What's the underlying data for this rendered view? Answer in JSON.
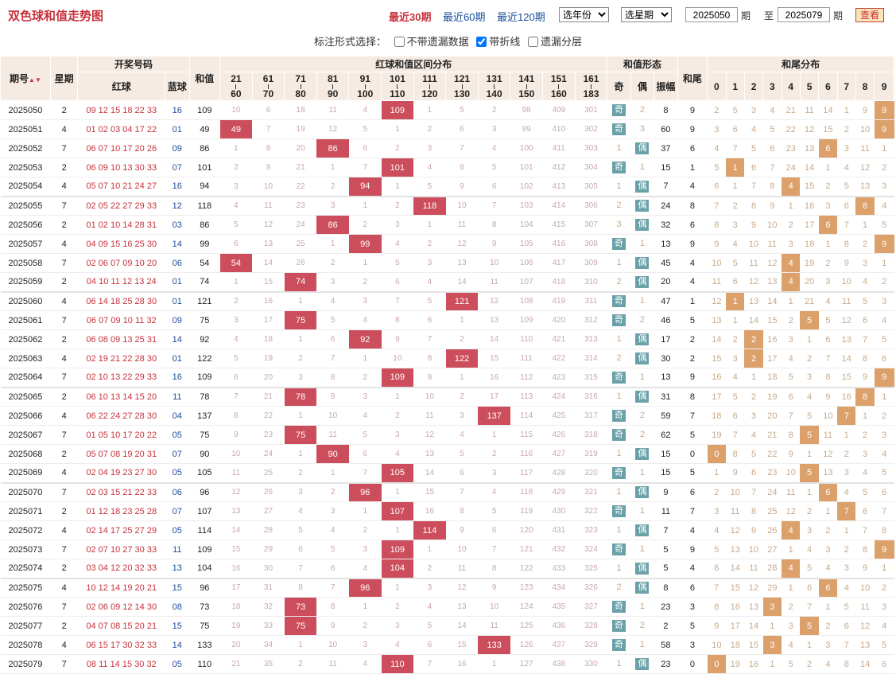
{
  "title": "双色球和值走势图",
  "ranges": [
    "最近30期",
    "最近60期",
    "最近120期"
  ],
  "selects": {
    "year": "选年份",
    "issue": "选星期"
  },
  "from_value": "2025050",
  "issue_word": "期",
  "to_word": "至",
  "to_value": "2025079",
  "query_btn": "查看",
  "options": {
    "label": "标注形式选择：",
    "opt1": "不带遗漏数据",
    "opt2": "带折线",
    "opt3": "遗漏分层",
    "opt2_checked": true
  },
  "header": {
    "issue": "期号",
    "sort": "▲▼",
    "week": "星期",
    "draw": "开奖号码",
    "red": "红球",
    "blue": "蓝球",
    "sum": "和值",
    "dist": "红球和值区间分布",
    "form": "和值形态",
    "odd": "奇",
    "even": "偶",
    "amp": "振幅",
    "tail": "和尾",
    "taildist": "和尾分布",
    "ranges": [
      [
        "21",
        "60"
      ],
      [
        "61",
        "70"
      ],
      [
        "71",
        "80"
      ],
      [
        "81",
        "90"
      ],
      [
        "91",
        "100"
      ],
      [
        "101",
        "110"
      ],
      [
        "111",
        "120"
      ],
      [
        "121",
        "130"
      ],
      [
        "131",
        "140"
      ],
      [
        "141",
        "150"
      ],
      [
        "151",
        "160"
      ],
      [
        "161",
        "183"
      ]
    ],
    "digits": [
      "0",
      "1",
      "2",
      "3",
      "4",
      "5",
      "6",
      "7",
      "8",
      "9"
    ]
  },
  "rows": [
    {
      "issue": "2025050",
      "week": "2",
      "red": "09 12 15 18 22 33",
      "blue": "16",
      "sum": "109",
      "dist": [
        "10",
        "6",
        "18",
        "11",
        "4",
        "109",
        "1",
        "5",
        "2",
        "98",
        "409",
        "301"
      ],
      "hit": 5,
      "odd": true,
      "p": "2",
      "amp": "8",
      "tail": "9",
      "td": [
        "2",
        "5",
        "3",
        "4",
        "21",
        "11",
        "14",
        "1",
        "9",
        "9"
      ],
      "th": 9
    },
    {
      "issue": "2025051",
      "week": "4",
      "red": "01 02 03 04 17 22",
      "blue": "01",
      "sum": "49",
      "dist": [
        "49",
        "7",
        "19",
        "12",
        "5",
        "1",
        "2",
        "6",
        "3",
        "99",
        "410",
        "302"
      ],
      "hit": 0,
      "odd": true,
      "p": "3",
      "amp": "60",
      "tail": "9",
      "td": [
        "3",
        "6",
        "4",
        "5",
        "22",
        "12",
        "15",
        "2",
        "10",
        "9"
      ],
      "th": 9
    },
    {
      "issue": "2025052",
      "week": "7",
      "red": "06 07 10 17 20 26",
      "blue": "09",
      "sum": "86",
      "dist": [
        "1",
        "8",
        "20",
        "86",
        "6",
        "2",
        "3",
        "7",
        "4",
        "100",
        "411",
        "303"
      ],
      "hit": 3,
      "odd": false,
      "p": "1",
      "amp": "37",
      "tail": "6",
      "td": [
        "4",
        "7",
        "5",
        "6",
        "23",
        "13",
        "6",
        "3",
        "11",
        "1"
      ],
      "th": 6
    },
    {
      "issue": "2025053",
      "week": "2",
      "red": "06 09 10 13 30 33",
      "blue": "07",
      "sum": "101",
      "dist": [
        "2",
        "9",
        "21",
        "1",
        "7",
        "101",
        "4",
        "8",
        "5",
        "101",
        "412",
        "304"
      ],
      "hit": 5,
      "odd": true,
      "p": "1",
      "amp": "15",
      "tail": "1",
      "td": [
        "5",
        "1",
        "6",
        "7",
        "24",
        "14",
        "1",
        "4",
        "12",
        "2"
      ],
      "th": 1
    },
    {
      "issue": "2025054",
      "week": "4",
      "red": "05 07 10 21 24 27",
      "blue": "16",
      "sum": "94",
      "dist": [
        "3",
        "10",
        "22",
        "2",
        "94",
        "1",
        "5",
        "9",
        "6",
        "102",
        "413",
        "305"
      ],
      "hit": 4,
      "odd": false,
      "p": "1",
      "amp": "7",
      "tail": "4",
      "td": [
        "6",
        "1",
        "7",
        "8",
        "4",
        "15",
        "2",
        "5",
        "13",
        "3"
      ],
      "th": 4
    },
    {
      "issue": "2025055",
      "week": "7",
      "red": "02 05 22 27 29 33",
      "blue": "12",
      "sum": "118",
      "dist": [
        "4",
        "11",
        "23",
        "3",
        "1",
        "2",
        "118",
        "10",
        "7",
        "103",
        "414",
        "306"
      ],
      "hit": 6,
      "odd": false,
      "p": "2",
      "amp": "24",
      "tail": "8",
      "td": [
        "7",
        "2",
        "8",
        "9",
        "1",
        "16",
        "3",
        "6",
        "8",
        "4"
      ],
      "th": 8
    },
    {
      "issue": "2025056",
      "week": "2",
      "red": "01 02 10 14 28 31",
      "blue": "03",
      "sum": "86",
      "dist": [
        "5",
        "12",
        "24",
        "86",
        "2",
        "3",
        "1",
        "11",
        "8",
        "104",
        "415",
        "307"
      ],
      "hit": 3,
      "odd": false,
      "p": "3",
      "amp": "32",
      "tail": "6",
      "td": [
        "8",
        "3",
        "9",
        "10",
        "2",
        "17",
        "6",
        "7",
        "1",
        "5"
      ],
      "th": 6
    },
    {
      "issue": "2025057",
      "week": "4",
      "red": "04 09 15 16 25 30",
      "blue": "14",
      "sum": "99",
      "dist": [
        "6",
        "13",
        "25",
        "1",
        "99",
        "4",
        "2",
        "12",
        "9",
        "105",
        "416",
        "308"
      ],
      "hit": 4,
      "odd": true,
      "p": "1",
      "amp": "13",
      "tail": "9",
      "td": [
        "9",
        "4",
        "10",
        "11",
        "3",
        "18",
        "1",
        "8",
        "2",
        "9"
      ],
      "th": 9
    },
    {
      "issue": "2025058",
      "week": "7",
      "red": "02 06 07 09 10 20",
      "blue": "06",
      "sum": "54",
      "dist": [
        "54",
        "14",
        "26",
        "2",
        "1",
        "5",
        "3",
        "13",
        "10",
        "106",
        "417",
        "309"
      ],
      "hit": 0,
      "odd": false,
      "p": "1",
      "amp": "45",
      "tail": "4",
      "td": [
        "10",
        "5",
        "11",
        "12",
        "4",
        "19",
        "2",
        "9",
        "3",
        "1"
      ],
      "th": 4
    },
    {
      "issue": "2025059",
      "week": "2",
      "red": "04 10 11 12 13 24",
      "blue": "01",
      "sum": "74",
      "dist": [
        "1",
        "15",
        "74",
        "3",
        "2",
        "6",
        "4",
        "14",
        "11",
        "107",
        "418",
        "310"
      ],
      "hit": 2,
      "odd": false,
      "p": "2",
      "amp": "20",
      "tail": "4",
      "td": [
        "11",
        "6",
        "12",
        "13",
        "4",
        "20",
        "3",
        "10",
        "4",
        "2"
      ],
      "th": 4
    },
    {
      "issue": "2025060",
      "week": "4",
      "red": "06 14 18 25 28 30",
      "blue": "01",
      "sum": "121",
      "dist": [
        "2",
        "16",
        "1",
        "4",
        "3",
        "7",
        "5",
        "121",
        "12",
        "108",
        "419",
        "311"
      ],
      "hit": 7,
      "odd": true,
      "p": "1",
      "amp": "47",
      "tail": "1",
      "td": [
        "12",
        "1",
        "13",
        "14",
        "1",
        "21",
        "4",
        "11",
        "5",
        "3"
      ],
      "th": 1
    },
    {
      "issue": "2025061",
      "week": "7",
      "red": "06 07 09 10 11 32",
      "blue": "09",
      "sum": "75",
      "dist": [
        "3",
        "17",
        "75",
        "5",
        "4",
        "8",
        "6",
        "1",
        "13",
        "109",
        "420",
        "312"
      ],
      "hit": 2,
      "odd": true,
      "p": "2",
      "amp": "46",
      "tail": "5",
      "td": [
        "13",
        "1",
        "14",
        "15",
        "2",
        "5",
        "5",
        "12",
        "6",
        "4"
      ],
      "th": 5
    },
    {
      "issue": "2025062",
      "week": "2",
      "red": "06 08 09 13 25 31",
      "blue": "14",
      "sum": "92",
      "dist": [
        "4",
        "18",
        "1",
        "6",
        "92",
        "9",
        "7",
        "2",
        "14",
        "110",
        "421",
        "313"
      ],
      "hit": 4,
      "odd": false,
      "p": "1",
      "amp": "17",
      "tail": "2",
      "td": [
        "14",
        "2",
        "2",
        "16",
        "3",
        "1",
        "6",
        "13",
        "7",
        "5"
      ],
      "th": 2
    },
    {
      "issue": "2025063",
      "week": "4",
      "red": "02 19 21 22 28 30",
      "blue": "01",
      "sum": "122",
      "dist": [
        "5",
        "19",
        "2",
        "7",
        "1",
        "10",
        "8",
        "122",
        "15",
        "111",
        "422",
        "314"
      ],
      "hit": 7,
      "odd": false,
      "p": "2",
      "amp": "30",
      "tail": "2",
      "td": [
        "15",
        "3",
        "2",
        "17",
        "4",
        "2",
        "7",
        "14",
        "8",
        "6"
      ],
      "th": 2
    },
    {
      "issue": "2025064",
      "week": "7",
      "red": "02 10 13 22 29 33",
      "blue": "16",
      "sum": "109",
      "dist": [
        "6",
        "20",
        "3",
        "8",
        "2",
        "109",
        "9",
        "1",
        "16",
        "112",
        "423",
        "315"
      ],
      "hit": 5,
      "odd": true,
      "p": "1",
      "amp": "13",
      "tail": "9",
      "td": [
        "16",
        "4",
        "1",
        "18",
        "5",
        "3",
        "8",
        "15",
        "9",
        "9"
      ],
      "th": 9
    },
    {
      "issue": "2025065",
      "week": "2",
      "red": "06 10 13 14 15 20",
      "blue": "11",
      "sum": "78",
      "dist": [
        "7",
        "21",
        "78",
        "9",
        "3",
        "1",
        "10",
        "2",
        "17",
        "113",
        "424",
        "316"
      ],
      "hit": 2,
      "odd": false,
      "p": "1",
      "amp": "31",
      "tail": "8",
      "td": [
        "17",
        "5",
        "2",
        "19",
        "6",
        "4",
        "9",
        "16",
        "8",
        "1"
      ],
      "th": 8
    },
    {
      "issue": "2025066",
      "week": "4",
      "red": "06 22 24 27 28 30",
      "blue": "04",
      "sum": "137",
      "dist": [
        "8",
        "22",
        "1",
        "10",
        "4",
        "2",
        "11",
        "3",
        "137",
        "114",
        "425",
        "317"
      ],
      "hit": 8,
      "odd": true,
      "p": "2",
      "amp": "59",
      "tail": "7",
      "td": [
        "18",
        "6",
        "3",
        "20",
        "7",
        "5",
        "10",
        "7",
        "1",
        "2"
      ],
      "th": 7
    },
    {
      "issue": "2025067",
      "week": "7",
      "red": "01 05 10 17 20 22",
      "blue": "05",
      "sum": "75",
      "dist": [
        "9",
        "23",
        "75",
        "11",
        "5",
        "3",
        "12",
        "4",
        "1",
        "115",
        "426",
        "318"
      ],
      "hit": 2,
      "odd": true,
      "p": "2",
      "amp": "62",
      "tail": "5",
      "td": [
        "19",
        "7",
        "4",
        "21",
        "8",
        "5",
        "11",
        "1",
        "2",
        "3"
      ],
      "th": 5
    },
    {
      "issue": "2025068",
      "week": "2",
      "red": "05 07 08 19 20 31",
      "blue": "07",
      "sum": "90",
      "dist": [
        "10",
        "24",
        "1",
        "90",
        "6",
        "4",
        "13",
        "5",
        "2",
        "116",
        "427",
        "319"
      ],
      "hit": 3,
      "odd": false,
      "p": "1",
      "amp": "15",
      "tail": "0",
      "td": [
        "0",
        "8",
        "5",
        "22",
        "9",
        "1",
        "12",
        "2",
        "3",
        "4"
      ],
      "th": 0
    },
    {
      "issue": "2025069",
      "week": "4",
      "red": "02 04 19 23 27 30",
      "blue": "05",
      "sum": "105",
      "dist": [
        "11",
        "25",
        "2",
        "1",
        "7",
        "105",
        "14",
        "6",
        "3",
        "117",
        "428",
        "320"
      ],
      "hit": 5,
      "odd": true,
      "p": "1",
      "amp": "15",
      "tail": "5",
      "td": [
        "1",
        "9",
        "6",
        "23",
        "10",
        "5",
        "13",
        "3",
        "4",
        "5"
      ],
      "th": 5
    },
    {
      "issue": "2025070",
      "week": "7",
      "red": "02 03 15 21 22 33",
      "blue": "06",
      "sum": "96",
      "dist": [
        "12",
        "26",
        "3",
        "2",
        "96",
        "1",
        "15",
        "7",
        "4",
        "118",
        "429",
        "321"
      ],
      "hit": 4,
      "odd": false,
      "p": "1",
      "amp": "9",
      "tail": "6",
      "td": [
        "2",
        "10",
        "7",
        "24",
        "11",
        "1",
        "6",
        "4",
        "5",
        "6"
      ],
      "th": 6
    },
    {
      "issue": "2025071",
      "week": "2",
      "red": "01 12 18 23 25 28",
      "blue": "07",
      "sum": "107",
      "dist": [
        "13",
        "27",
        "4",
        "3",
        "1",
        "107",
        "16",
        "8",
        "5",
        "119",
        "430",
        "322"
      ],
      "hit": 5,
      "odd": true,
      "p": "1",
      "amp": "11",
      "tail": "7",
      "td": [
        "3",
        "11",
        "8",
        "25",
        "12",
        "2",
        "1",
        "7",
        "6",
        "7"
      ],
      "th": 7
    },
    {
      "issue": "2025072",
      "week": "4",
      "red": "02 14 17 25 27 29",
      "blue": "05",
      "sum": "114",
      "dist": [
        "14",
        "28",
        "5",
        "4",
        "2",
        "1",
        "114",
        "9",
        "6",
        "120",
        "431",
        "323"
      ],
      "hit": 6,
      "odd": false,
      "p": "1",
      "amp": "7",
      "tail": "4",
      "td": [
        "4",
        "12",
        "9",
        "26",
        "4",
        "3",
        "2",
        "1",
        "7",
        "8"
      ],
      "th": 4
    },
    {
      "issue": "2025073",
      "week": "7",
      "red": "02 07 10 27 30 33",
      "blue": "11",
      "sum": "109",
      "dist": [
        "15",
        "29",
        "6",
        "5",
        "3",
        "109",
        "1",
        "10",
        "7",
        "121",
        "432",
        "324"
      ],
      "hit": 5,
      "odd": true,
      "p": "1",
      "amp": "5",
      "tail": "9",
      "td": [
        "5",
        "13",
        "10",
        "27",
        "1",
        "4",
        "3",
        "2",
        "8",
        "9"
      ],
      "th": 9
    },
    {
      "issue": "2025074",
      "week": "2",
      "red": "03 04 12 20 32 33",
      "blue": "13",
      "sum": "104",
      "dist": [
        "16",
        "30",
        "7",
        "6",
        "4",
        "104",
        "2",
        "11",
        "8",
        "122",
        "433",
        "325"
      ],
      "hit": 5,
      "odd": false,
      "p": "1",
      "amp": "5",
      "tail": "4",
      "td": [
        "6",
        "14",
        "11",
        "28",
        "4",
        "5",
        "4",
        "3",
        "9",
        "1"
      ],
      "th": 4
    },
    {
      "issue": "2025075",
      "week": "4",
      "red": "10 12 14 19 20 21",
      "blue": "15",
      "sum": "96",
      "dist": [
        "17",
        "31",
        "8",
        "7",
        "96",
        "1",
        "3",
        "12",
        "9",
        "123",
        "434",
        "326"
      ],
      "hit": 4,
      "odd": false,
      "p": "2",
      "amp": "8",
      "tail": "6",
      "td": [
        "7",
        "15",
        "12",
        "29",
        "1",
        "6",
        "6",
        "4",
        "10",
        "2"
      ],
      "th": 6
    },
    {
      "issue": "2025076",
      "week": "7",
      "red": "02 06 09 12 14 30",
      "blue": "08",
      "sum": "73",
      "dist": [
        "18",
        "32",
        "73",
        "8",
        "1",
        "2",
        "4",
        "13",
        "10",
        "124",
        "435",
        "327"
      ],
      "hit": 2,
      "odd": true,
      "p": "1",
      "amp": "23",
      "tail": "3",
      "td": [
        "8",
        "16",
        "13",
        "3",
        "2",
        "7",
        "1",
        "5",
        "11",
        "3"
      ],
      "th": 3
    },
    {
      "issue": "2025077",
      "week": "2",
      "red": "04 07 08 15 20 21",
      "blue": "15",
      "sum": "75",
      "dist": [
        "19",
        "33",
        "75",
        "9",
        "2",
        "3",
        "5",
        "14",
        "11",
        "125",
        "436",
        "328"
      ],
      "hit": 2,
      "odd": true,
      "p": "2",
      "amp": "2",
      "tail": "5",
      "td": [
        "9",
        "17",
        "14",
        "1",
        "3",
        "5",
        "2",
        "6",
        "12",
        "4"
      ],
      "th": 5
    },
    {
      "issue": "2025078",
      "week": "4",
      "red": "06 15 17 30 32 33",
      "blue": "14",
      "sum": "133",
      "dist": [
        "20",
        "34",
        "1",
        "10",
        "3",
        "4",
        "6",
        "15",
        "133",
        "126",
        "437",
        "329"
      ],
      "hit": 8,
      "odd": true,
      "p": "1",
      "amp": "58",
      "tail": "3",
      "td": [
        "10",
        "18",
        "15",
        "3",
        "4",
        "1",
        "3",
        "7",
        "13",
        "5"
      ],
      "th": 3
    },
    {
      "issue": "2025079",
      "week": "7",
      "red": "08 11 14 15 30 32",
      "blue": "05",
      "sum": "110",
      "dist": [
        "21",
        "35",
        "2",
        "11",
        "4",
        "110",
        "7",
        "16",
        "1",
        "127",
        "438",
        "330"
      ],
      "hit": 5,
      "odd": false,
      "p": "1",
      "amp": "23",
      "tail": "0",
      "td": [
        "0",
        "19",
        "16",
        "1",
        "5",
        "2",
        "4",
        "8",
        "14",
        "6"
      ],
      "th": 0
    }
  ]
}
